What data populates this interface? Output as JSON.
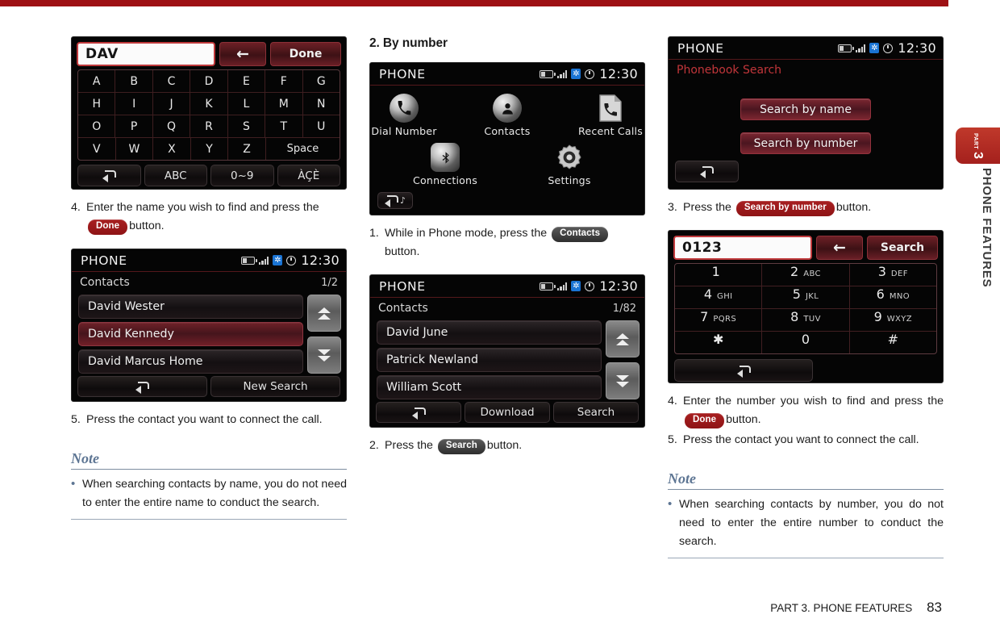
{
  "document": {
    "footer_label": "PART 3. PHONE FEATURES",
    "page_number": "83",
    "side_tab_part": "PART",
    "side_tab_number": "3",
    "side_tab_label": "PHONE FEATURES",
    "accent_red": "#9e1114",
    "note_blue": "#5d7593"
  },
  "col1": {
    "screen_keyboard": {
      "input_value": "DAV",
      "back_arrow": "←",
      "done_label": "Done",
      "rows": [
        [
          "A",
          "B",
          "C",
          "D",
          "E",
          "F",
          "G"
        ],
        [
          "H",
          "I",
          "J",
          "K",
          "L",
          "M",
          "N"
        ],
        [
          "O",
          "P",
          "Q",
          "R",
          "S",
          "T",
          "U"
        ],
        [
          "V",
          "W",
          "X",
          "Y",
          "Z",
          "Space"
        ]
      ],
      "footer_buttons": [
        "ABC",
        "0~9",
        "ÀÇÈ"
      ]
    },
    "step4": {
      "num": "4.",
      "text_before": "Enter the name you wish to find and press the",
      "badge": "Done",
      "text_after": "button."
    },
    "screen_contacts": {
      "title": "PHONE",
      "time": "12:30",
      "subtitle": "Contacts",
      "count": "1/2",
      "rows": [
        "David Wester",
        "David Kennedy",
        "David Marcus Home"
      ],
      "selected_index": 1,
      "bottom_buttons": [
        "",
        "New Search"
      ]
    },
    "step5": {
      "num": "5.",
      "text": "Press the contact you want to connect the call."
    },
    "note": {
      "heading": "Note",
      "bullet": "•",
      "text": "When searching contacts by name, you do not need to enter the entire name to conduct the search."
    }
  },
  "col2": {
    "section_title": "2. By number",
    "screen_home": {
      "title": "PHONE",
      "time": "12:30",
      "items": [
        {
          "label": "Dial Number",
          "icon": "phone-handset-icon"
        },
        {
          "label": "Contacts",
          "icon": "contacts-person-icon"
        },
        {
          "label": "Recent Calls",
          "icon": "recent-calls-icon"
        },
        {
          "label": "Connections",
          "icon": "bluetooth-connections-icon"
        },
        {
          "label": "Settings",
          "icon": "gear-settings-icon"
        }
      ]
    },
    "step1": {
      "num": "1.",
      "text_before": "While in Phone mode, press the",
      "badge": "Contacts",
      "text_after": "button."
    },
    "screen_contacts": {
      "title": "PHONE",
      "time": "12:30",
      "subtitle": "Contacts",
      "count": "1/82",
      "rows": [
        "David June",
        "Patrick Newland",
        "William Scott"
      ],
      "bottom_buttons": [
        "",
        "Download",
        "Search"
      ]
    },
    "step2": {
      "num": "2.",
      "text_before": "Press the",
      "badge": "Search",
      "text_after": "button."
    }
  },
  "col3": {
    "screen_phonebook": {
      "title": "PHONE",
      "time": "12:30",
      "subtitle": "Phonebook Search",
      "buttons": [
        "Search by name",
        "Search by number"
      ]
    },
    "step3": {
      "num": "3.",
      "text_before": "Press the",
      "badge": "Search by number",
      "text_after": "button."
    },
    "screen_keypad": {
      "input_value": "0123",
      "back_arrow": "←",
      "search_label": "Search",
      "keys": [
        [
          {
            "d": "1",
            "l": ""
          },
          {
            "d": "2",
            "l": "ABC"
          },
          {
            "d": "3",
            "l": "DEF"
          }
        ],
        [
          {
            "d": "4",
            "l": "GHI"
          },
          {
            "d": "5",
            "l": "JKL"
          },
          {
            "d": "6",
            "l": "MNO"
          }
        ],
        [
          {
            "d": "7",
            "l": "PQRS"
          },
          {
            "d": "8",
            "l": "TUV"
          },
          {
            "d": "9",
            "l": "WXYZ"
          }
        ],
        [
          {
            "d": "✱",
            "l": ""
          },
          {
            "d": "0",
            "l": ""
          },
          {
            "d": "#",
            "l": ""
          }
        ]
      ]
    },
    "step4": {
      "num": "4.",
      "text_before": "Enter the number you wish to find and press the",
      "badge": "Done",
      "text_after": "button."
    },
    "step5": {
      "num": "5.",
      "text": "Press the contact you want to connect the call."
    },
    "note": {
      "heading": "Note",
      "bullet": "•",
      "text": "When searching contacts by number, you do not need to enter the entire number to conduct the search."
    }
  }
}
